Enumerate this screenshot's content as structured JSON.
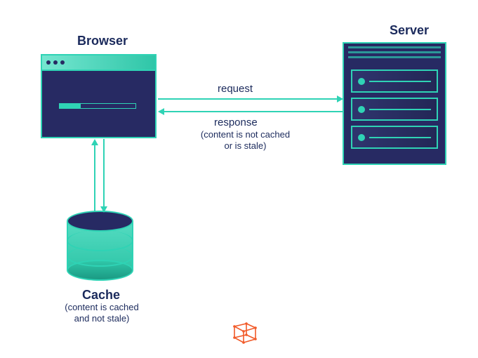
{
  "browser": {
    "title": "Browser"
  },
  "server": {
    "title": "Server"
  },
  "cache": {
    "title": "Cache",
    "subtitle_line1": "(content is cached",
    "subtitle_line2": "and not stale)"
  },
  "request": {
    "label": "request"
  },
  "response": {
    "label": "response",
    "subtitle_line1": "(content is not cached",
    "subtitle_line2": "or is stale)"
  },
  "colors": {
    "teal": "#2fd3b5",
    "navy": "#272a63",
    "text": "#1b2a5c",
    "orange": "#f15a29"
  }
}
